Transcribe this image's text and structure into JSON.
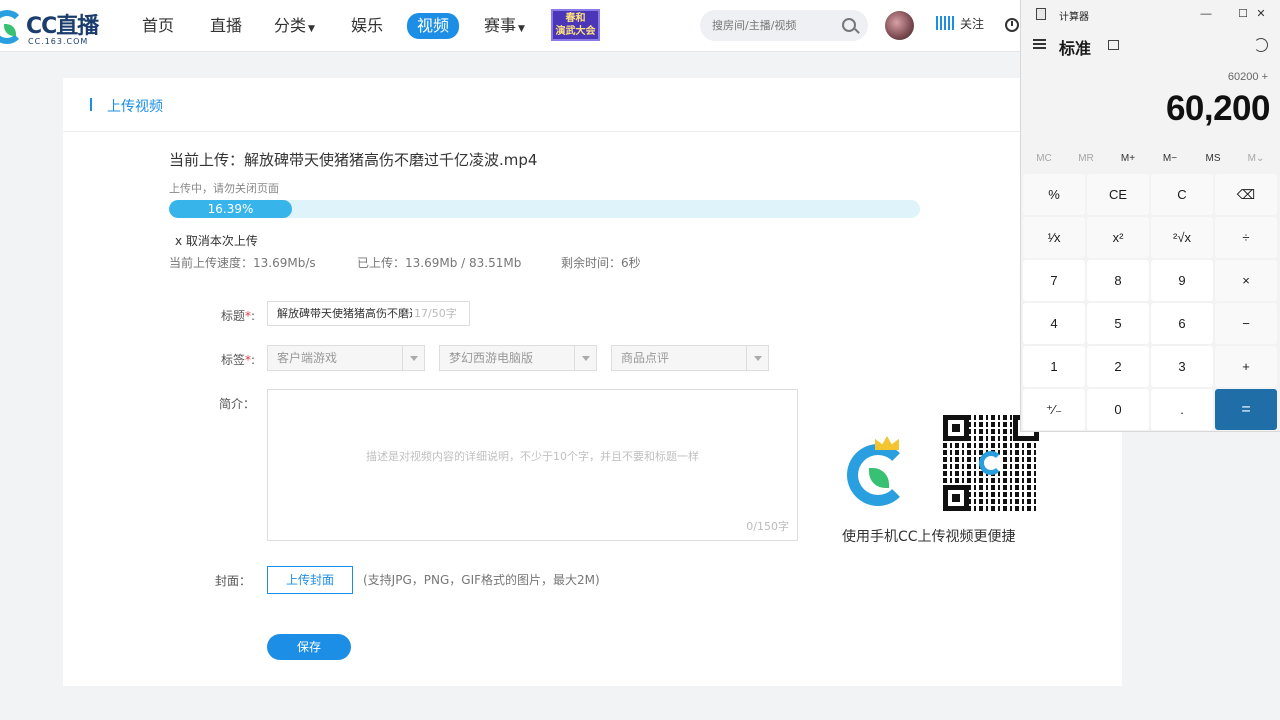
{
  "nav": {
    "logo_text": "CC直播",
    "logo_sub": "CC.163.COM",
    "items": [
      {
        "label": "首页"
      },
      {
        "label": "直播"
      },
      {
        "label": "分类"
      },
      {
        "label": "娱乐"
      },
      {
        "label": "视频"
      },
      {
        "label": "赛事"
      }
    ],
    "spring_badge_line1": "春和",
    "spring_badge_line2": "演武大会",
    "search_placeholder": "搜房间/主播/视频",
    "follow_label": "关注",
    "accent": "#1d8ee6"
  },
  "panel": {
    "header": "上传视频",
    "current_upload_label": "当前上传：",
    "current_upload_file": "解放碑带天使猪猪高伤不磨过千亿凌波.mp4",
    "uploading_tip": "上传中，请勿关闭页面",
    "progress_percent": 16.39,
    "progress_text": "16.39%",
    "cancel_label": "x 取消本次上传",
    "speed": "当前上传速度：13.69Mb/s",
    "uploaded": "已上传：13.69Mb / 83.51Mb",
    "remaining": "剩余时间：6秒",
    "form": {
      "title_label": "标题",
      "title_value": "解放碑带天使猪猪高伤不磨过",
      "title_count": "17/50字",
      "tags_label": "标签",
      "tag1": "客户端游戏",
      "tag2": "梦幻西游电脑版",
      "tag3": "商品点评",
      "intro_label": "简介：",
      "intro_placeholder": "描述是对视频内容的详细说明，不少于10个字，并且不要和标题一样",
      "intro_count": "0/150字",
      "cover_label": "封面：",
      "cover_button": "上传封面",
      "cover_hint": "(支持JPG，PNG，GIF格式的图片，最大2M)",
      "save_button": "保存"
    },
    "mobile_tip": "使用手机CC上传视频更便捷"
  },
  "calculator": {
    "app_title": "计算器",
    "minimize": "—",
    "maximize": "☐",
    "close": "✕",
    "mode": "标准",
    "expression": "60200 +",
    "display": "60,200",
    "memory": [
      "MC",
      "MR",
      "M+",
      "M−",
      "MS",
      "M⌄"
    ],
    "keys": [
      [
        "%",
        "CE",
        "C",
        "⌫"
      ],
      [
        "¹⁄x",
        "x²",
        "²√x",
        "÷"
      ],
      [
        "7",
        "8",
        "9",
        "×"
      ],
      [
        "4",
        "5",
        "6",
        "−"
      ],
      [
        "1",
        "2",
        "3",
        "+"
      ],
      [
        "⁺⁄₋",
        "0",
        ".",
        "="
      ]
    ]
  }
}
